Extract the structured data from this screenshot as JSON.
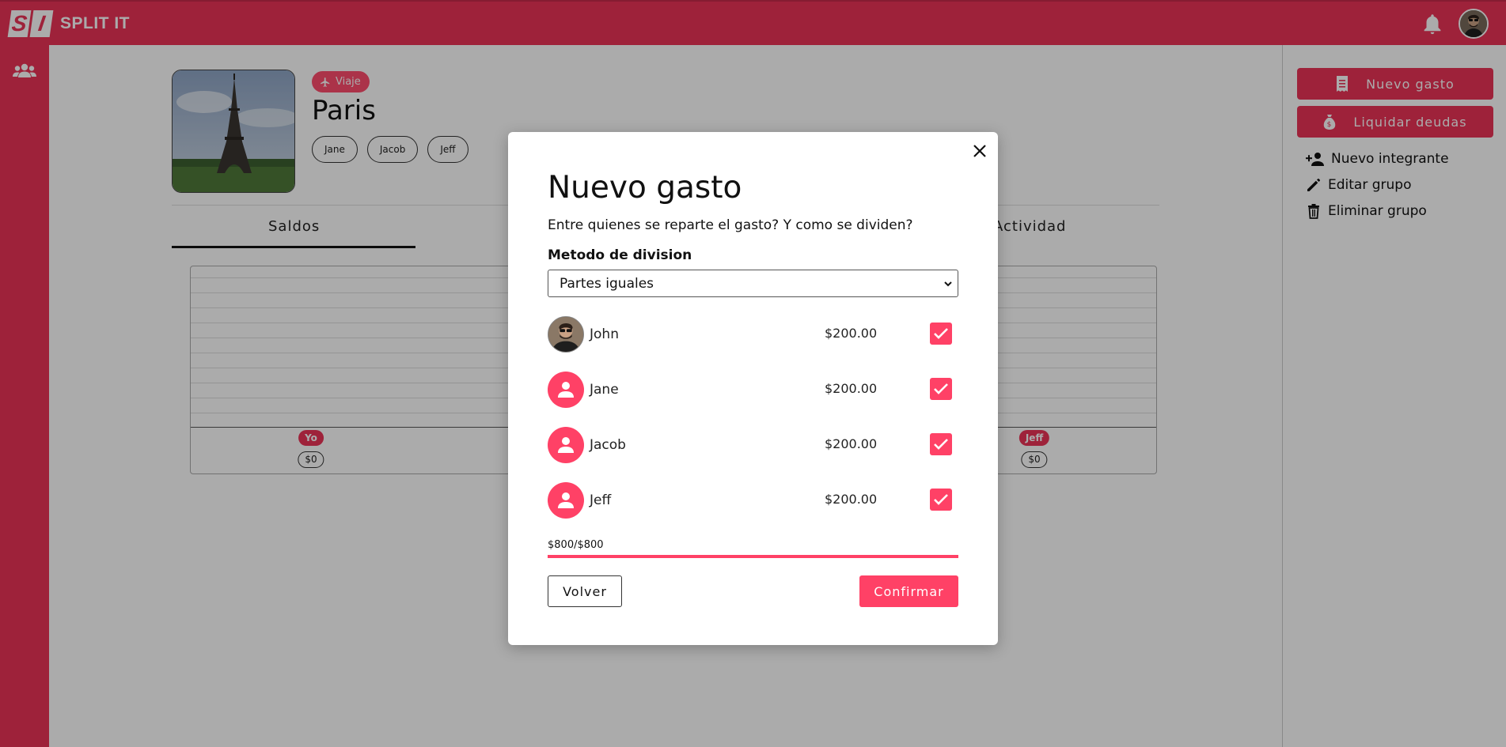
{
  "app": {
    "name": "SPLIT IT",
    "logo_letters": [
      "S",
      "I"
    ]
  },
  "group": {
    "type_badge": "Viaje",
    "name": "Paris",
    "members": [
      "Jane",
      "Jacob",
      "Jeff"
    ]
  },
  "tabs": [
    {
      "label": "Saldos",
      "active": true
    },
    {
      "label": "Actividad",
      "active": false
    }
  ],
  "balances": [
    {
      "label": "Yo",
      "value": "$0"
    },
    {
      "label": "Jeff",
      "value": "$0"
    }
  ],
  "actions": {
    "new_expense": "Nuevo gasto",
    "settle_debts": "Liquidar deudas",
    "new_member": "Nuevo integrante",
    "edit_group": "Editar grupo",
    "delete_group": "Eliminar grupo"
  },
  "modal": {
    "title": "Nuevo gasto",
    "subtitle": "Entre quienes se reparte el gasto? Y como se dividen?",
    "method_label": "Metodo de division",
    "method_value": "Partes iguales",
    "participants": [
      {
        "name": "John",
        "amount": "$200.00",
        "checked": true,
        "avatar": "photo"
      },
      {
        "name": "Jane",
        "amount": "$200.00",
        "checked": true,
        "avatar": "person-icon"
      },
      {
        "name": "Jacob",
        "amount": "$200.00",
        "checked": true,
        "avatar": "person-icon"
      },
      {
        "name": "Jeff",
        "amount": "$200.00",
        "checked": true,
        "avatar": "person-icon"
      }
    ],
    "total_text": "$800/$800",
    "total_progress": 1.0,
    "back_label": "Volver",
    "confirm_label": "Confirmar"
  },
  "colors": {
    "brand": "#ec3357",
    "accent": "#ff4166",
    "overlay": "rgba(0,0,0,0.33)"
  }
}
